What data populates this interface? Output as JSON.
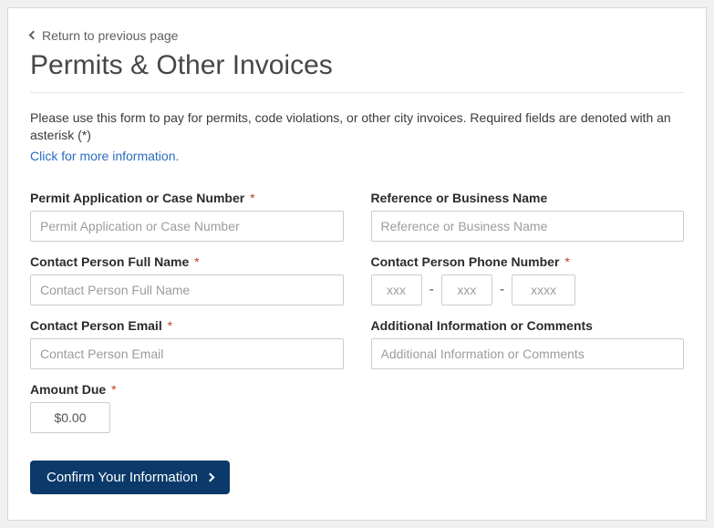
{
  "return_link": "Return to previous page",
  "page_title": "Permits & Other Invoices",
  "intro_text": "Please use this form to pay for permits, code violations, or other city invoices. Required fields are denoted with an asterisk (*)",
  "more_info_link": "Click for more information.",
  "fields": {
    "permit_number": {
      "label": "Permit Application or Case Number",
      "placeholder": "Permit Application or Case Number",
      "required": true
    },
    "reference": {
      "label": "Reference or Business Name",
      "placeholder": "Reference or Business Name",
      "required": false
    },
    "contact_name": {
      "label": "Contact Person Full Name",
      "placeholder": "Contact Person Full Name",
      "required": true
    },
    "contact_phone": {
      "label": "Contact Person Phone Number",
      "required": true,
      "p1_placeholder": "xxx",
      "p2_placeholder": "xxx",
      "p3_placeholder": "xxxx",
      "dash": "-"
    },
    "contact_email": {
      "label": "Contact Person Email",
      "placeholder": "Contact Person Email",
      "required": true
    },
    "additional_info": {
      "label": "Additional Information or Comments",
      "placeholder": "Additional Information or Comments",
      "required": false
    },
    "amount_due": {
      "label": "Amount Due",
      "value": "$0.00",
      "required": true
    }
  },
  "required_marker": "*",
  "confirm_button": "Confirm Your Information"
}
